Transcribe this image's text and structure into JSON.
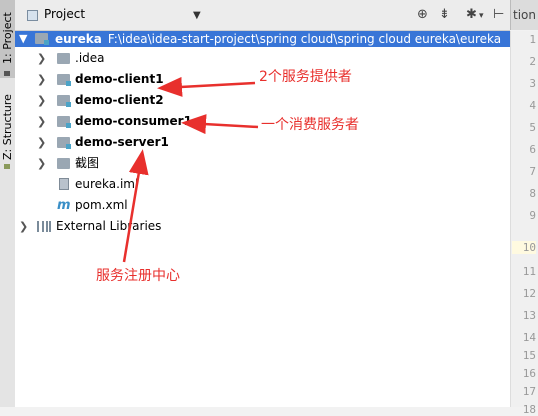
{
  "sidebar": {
    "tab_project": "1: Project",
    "tab_structure": "Z: Structure"
  },
  "header": {
    "title": "Project",
    "editor_tab_partial": "tion"
  },
  "tree": {
    "root": {
      "name": "eureka",
      "path": "F:\\idea\\idea-start-project\\spring cloud\\spring cloud eureka\\eureka"
    },
    "items": [
      {
        "label": ".idea"
      },
      {
        "label": "demo-client1"
      },
      {
        "label": "demo-client2"
      },
      {
        "label": "demo-consumer1"
      },
      {
        "label": "demo-server1"
      },
      {
        "label": "截图"
      },
      {
        "label": "eureka.iml"
      },
      {
        "label": "pom.xml"
      },
      {
        "label": "External Libraries"
      }
    ]
  },
  "line_numbers": [
    "1",
    "2",
    "3",
    "4",
    "5",
    "6",
    "7",
    "8",
    "9",
    "10",
    "11",
    "12",
    "13",
    "14",
    "15",
    "16",
    "17",
    "18"
  ],
  "annotations": {
    "providers": "2个服务提供者",
    "consumer": "一个消费服务者",
    "registry": "服务注册中心"
  },
  "colors": {
    "selection": "#3875d7",
    "annotation": "#e8302d"
  }
}
